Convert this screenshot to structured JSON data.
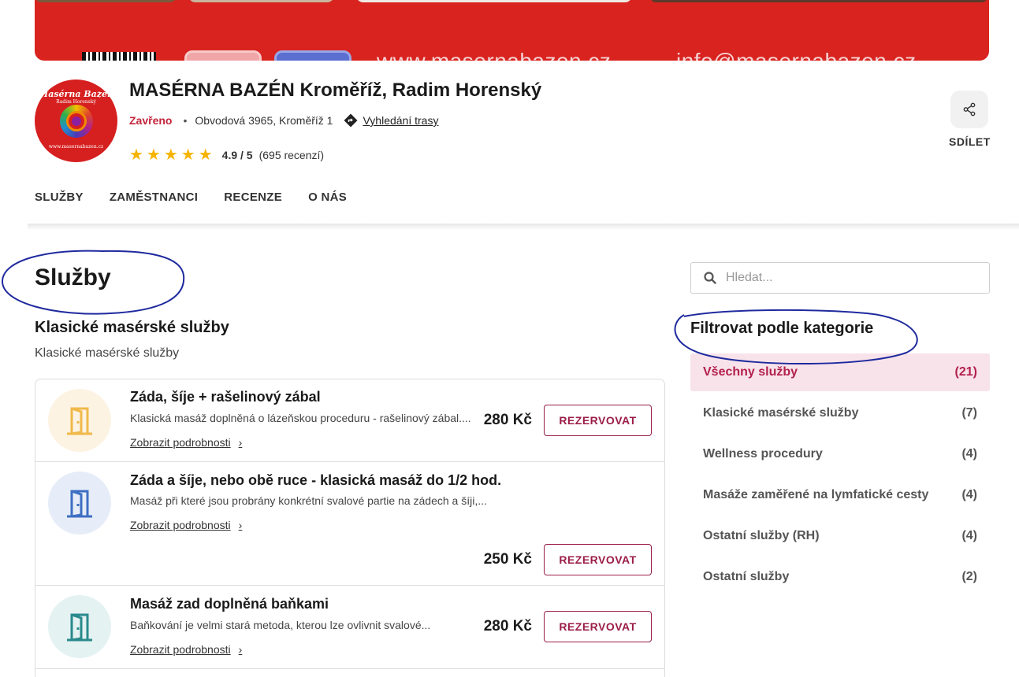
{
  "banner": {
    "website_text": "www.masernabazen.cz",
    "email_text": "info@masernabazen.cz"
  },
  "logo": {
    "line1": "Masérna Bazén",
    "line2": "Radim Horenský",
    "line3": "www.masernabazen.cz"
  },
  "business": {
    "name": "MASÉRNA BAZÉN Kroměříž, Radim Horenský",
    "status": "Zavřeno",
    "address": "Obvodová 3965, Kroměříž 1",
    "route_label": "Vyhledání trasy",
    "stars": "★★★★★",
    "score": "4.9 / 5",
    "reviews": "(695 recenzí)",
    "share_label": "SDÍLET"
  },
  "tabs": [
    "SLUŽBY",
    "ZAMĚSTNANCI",
    "RECENZE",
    "O NÁS"
  ],
  "main": {
    "heading": "Služby",
    "category_title": "Klasické masérské služby",
    "category_subtitle": "Klasické masérské služby",
    "items": [
      {
        "name": "Záda, šíje + rašelinový zábal",
        "desc": "Klasická masáž doplněná o lázeňskou proceduru - rašelinový zábal....",
        "more": "Zobrazit podrobnosti",
        "price": "280 Kč",
        "book": "REZERVOVAT",
        "icon_color": "#f0b94a",
        "icon_bg": "#fdf3e3"
      },
      {
        "name": "Záda a šíje, nebo obě ruce - klasická masáž do 1/2 hod.",
        "desc": "Masáž při které jsou probrány konkrétní svalové partie na zádech a šíji,...",
        "more": "Zobrazit podrobnosti",
        "price": "250 Kč",
        "book": "REZERVOVAT",
        "icon_color": "#3d6fc2",
        "icon_bg": "#e6edf8"
      },
      {
        "name": "Masáž zad doplněná baňkami",
        "desc": "Baňkování je velmi stará metoda, kterou lze ovlivnit svalové...",
        "more": "Zobrazit podrobnosti",
        "price": "280 Kč",
        "book": "REZERVOVAT",
        "icon_color": "#2a8a8c",
        "icon_bg": "#e4f2f2"
      }
    ]
  },
  "sidebar": {
    "search_placeholder": "Hledat...",
    "filter_heading": "Filtrovat podle kategorie",
    "filters": [
      {
        "label": "Všechny služby",
        "count": "(21)"
      },
      {
        "label": "Klasické masérské služby",
        "count": "(7)"
      },
      {
        "label": "Wellness procedury",
        "count": "(4)"
      },
      {
        "label": "Masáže zaměřené na lymfatické cesty",
        "count": "(4)"
      },
      {
        "label": "Ostatní služby (RH)",
        "count": "(4)"
      },
      {
        "label": "Ostatní služby",
        "count": "(2)"
      }
    ]
  },
  "colors": {
    "accent": "#b3204e",
    "banner": "#d9231f",
    "star": "#f5b400",
    "annotation": "#1f2a9e"
  }
}
